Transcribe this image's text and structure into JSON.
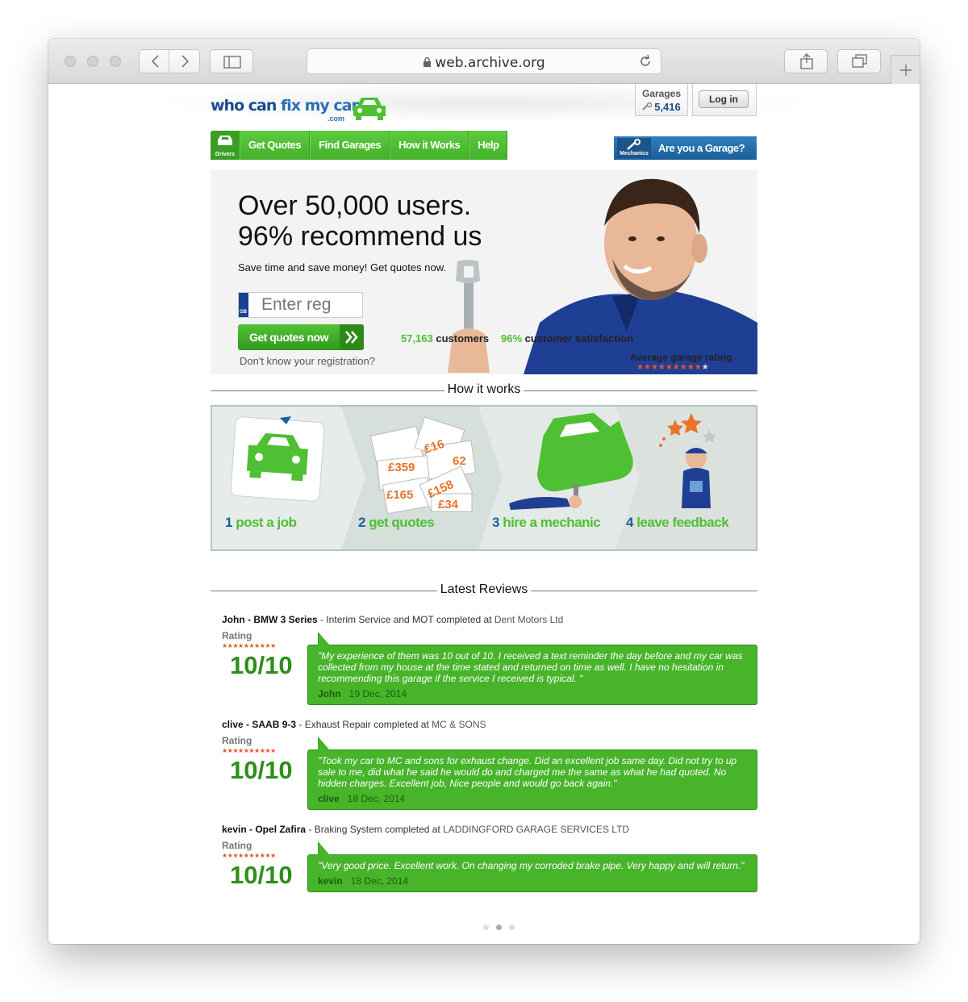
{
  "browser": {
    "url": "web.archive.org"
  },
  "header": {
    "logo_who": "who can ",
    "logo_fix": "fix my car",
    "logo_com": ".com",
    "garages_label": "Garages",
    "garages_count": "5,416",
    "login_label": "Log in"
  },
  "nav": {
    "drivers_label": "Drivers",
    "items": [
      "Get Quotes",
      "Find Garages",
      "How it Works",
      "Help"
    ],
    "mechanics_label": "Mechanics",
    "garage_cta": "Are you a Garage?"
  },
  "hero": {
    "headline_1": "Over 50,000 users.",
    "headline_2": "96% recommend us",
    "subtitle": "Save time and save money! Get quotes now.",
    "reg_placeholder": "Enter reg",
    "reg_country": "GB",
    "quote_button": "Get quotes now",
    "no_reg_link": "Don't know your registration?",
    "customers_num": "57,163",
    "customers_label": "customers",
    "satisfaction_num": "96%",
    "satisfaction_label": "customer satisfaction",
    "avg_rating_label": "Average garage rating",
    "avg_rating_stars": "★★★★★★★★★",
    "avg_rating_empty": "★"
  },
  "how_it_works": {
    "title": "How it works",
    "steps": [
      {
        "num": "1",
        "label": "post a job"
      },
      {
        "num": "2",
        "label": "get quotes"
      },
      {
        "num": "3",
        "label": "hire a mechanic"
      },
      {
        "num": "4",
        "label": "leave feedback"
      }
    ],
    "quote_prices": [
      "£359",
      "£165",
      "£158",
      "£34",
      "£16",
      "62"
    ]
  },
  "reviews": {
    "title": "Latest Reviews",
    "rating_label": "Rating",
    "stars": "★★★★★★★★★★",
    "items": [
      {
        "reviewer_car": "John - BMW 3 Series",
        "job": " - Interim Service and MOT completed at ",
        "garage": "Dent Motors Ltd",
        "score": "10/10",
        "quote": "\"My experience of them was 10 out of 10. I received a text reminder the day before and my car was collected from my house at the time stated and returned on time as well. I have no hesitation in recommending this garage if the service I received is typical. \"",
        "author": "John",
        "date": "19 Dec, 2014"
      },
      {
        "reviewer_car": "clive - SAAB 9-3",
        "job": " - Exhaust Repair completed at ",
        "garage": "MC & SONS",
        "score": "10/10",
        "quote": "\"Took my car to MC and sons for exhaust change. Did an excellent job same day. Did not try to up sale to me, did what he said he would do and charged me the same as what he had quoted. No hidden charges. Excellent job, Nice people and would go back again.\"",
        "author": "clive",
        "date": "18 Dec, 2014"
      },
      {
        "reviewer_car": "kevin - Opel Zafira",
        "job": " - Braking System completed at ",
        "garage": "LADDINGFORD GARAGE SERVICES LTD",
        "score": "10/10",
        "quote": "\"Very good price. Excellent work. On changing my corroded brake pipe. Very happy and will return.\"",
        "author": "kevin",
        "date": "18 Dec, 2014"
      }
    ]
  },
  "colors": {
    "brand_green": "#4fbf33",
    "brand_blue": "#1c5f98",
    "star_orange": "#e8542a"
  }
}
